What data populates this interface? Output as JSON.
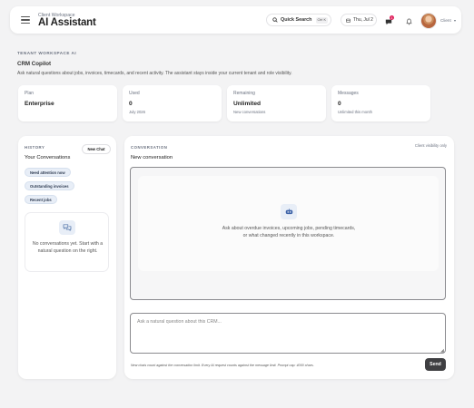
{
  "header": {
    "workspace_sub": "Client Workspace",
    "title": "AI Assistant",
    "quick_search": "Quick Search",
    "shortcut": "Ctrl K",
    "date": "Thu, Jul 2",
    "notification_count": "1",
    "user": "Client",
    "icons": [
      "menu-icon",
      "search-icon",
      "calendar-icon",
      "message-icon",
      "bell-icon",
      "chevron-down-icon"
    ]
  },
  "intro": {
    "section": "TENANT WORKSPACE AI",
    "title": "CRM Copilot",
    "description": "Ask natural questions about jobs, invoices, timecards, and recent activity. The assistant stays inside your current tenant and role visibility."
  },
  "stats": [
    {
      "label": "Plan",
      "value": "Enterprise",
      "sub": ""
    },
    {
      "label": "Used",
      "value": "0",
      "sub": "July 2026"
    },
    {
      "label": "Remaining",
      "value": "Unlimited",
      "sub": "New conversations"
    },
    {
      "label": "Messages",
      "value": "0",
      "sub": "Unlimited this month"
    }
  ],
  "history": {
    "section": "HISTORY",
    "title": "Your Conversations",
    "new_chat": "New Chat",
    "chips": [
      "Need attention now",
      "Outstanding invoices",
      "Recent jobs"
    ],
    "empty_text": "No conversations yet. Start with a natural question on the right."
  },
  "conversation": {
    "section": "CONVERSATION",
    "visibility": "Client visibility only",
    "title": "New conversation",
    "prompt": "Ask about overdue invoices, upcoming jobs, pending timecards, or what changed recently in this workspace.",
    "placeholder": "Ask a natural question about this CRM...",
    "footnote": "New chats count against the conversation limit. Every AI request counts against the message limit. Prompt cap: 4000 chars.",
    "send": "Send"
  }
}
